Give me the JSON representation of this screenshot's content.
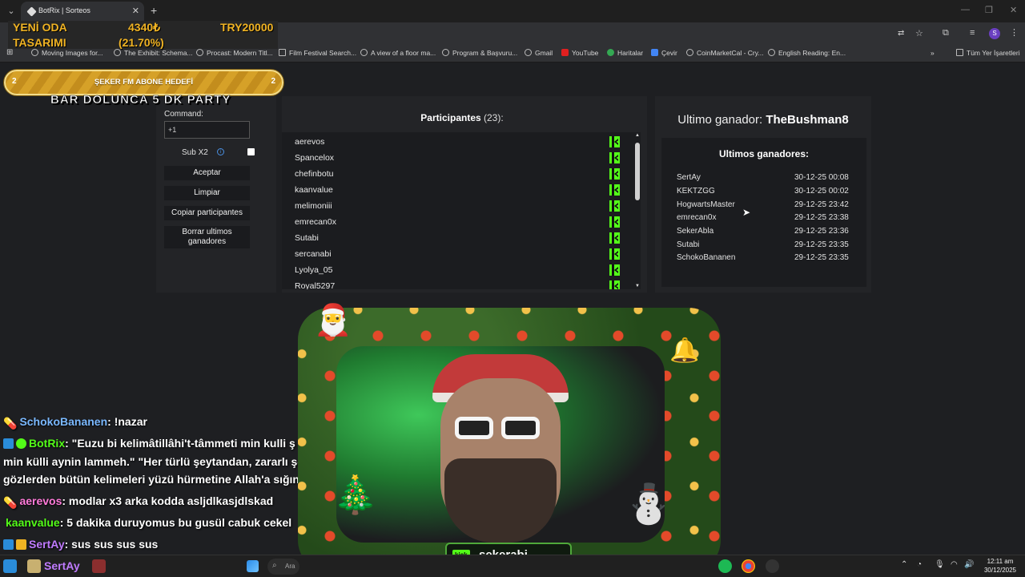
{
  "browser": {
    "tab_title": "BotRix | Sorteos",
    "new_tab": "+",
    "bookmarks": [
      {
        "label": "Moving Images for..."
      },
      {
        "label": "The Exhibit: Schema..."
      },
      {
        "label": "Procast: Modern Titl..."
      },
      {
        "label": "Film Festival Search..."
      },
      {
        "label": "A view of a floor ma..."
      },
      {
        "label": "Program & Başvuru..."
      },
      {
        "label": "Gmail"
      },
      {
        "label": "YouTube"
      },
      {
        "label": "Haritalar"
      },
      {
        "label": "Çevir"
      },
      {
        "label": "CoinMarketCal - Cry..."
      },
      {
        "label": "English Reading: En..."
      }
    ],
    "all_bookmarks": "Tüm Yer İşaretleri",
    "profile_initial": "S"
  },
  "stream_overlay": {
    "goal_label_line1": "YENİ ODA",
    "goal_label_line2": "TASARIMI",
    "amount": "4340₺",
    "percent": "(21.70%)",
    "target": "TRY20000",
    "progress_fraction": 0.217,
    "sub_goal": {
      "left_count": "2",
      "title": "ŞEKER FM ABONE HEDEFİ",
      "right_count": "2"
    },
    "party_text": "BAR DOLUNCA 5 DK PARTY"
  },
  "settings": {
    "command_label": "Command:",
    "command_value": "+1",
    "sub_x2_label": "Sub X2",
    "buttons": {
      "accept": "Aceptar",
      "clear": "Limpiar",
      "copy": "Copiar participantes",
      "delete_winners": "Borrar ultimos ganadores"
    }
  },
  "participants": {
    "title": "Participantes",
    "count": "(23):",
    "list": [
      "aerevos",
      "Spancelox",
      "chefinbotu",
      "kaanvalue",
      "melimoniii",
      "emrecan0x",
      "Sutabi",
      "sercanabi",
      "Lyolya_05",
      "Royal5297"
    ]
  },
  "winners": {
    "last_label": "Ultimo ganador:",
    "last_name": "TheBushman8",
    "list_title": "Ultimos ganadores:",
    "list": [
      {
        "name": "SertAy",
        "date": "30-12-25 00:08"
      },
      {
        "name": "KEKTZGG",
        "date": "30-12-25 00:02"
      },
      {
        "name": "HogwartsMaster",
        "date": "29-12-25 23:42"
      },
      {
        "name": "emrecan0x",
        "date": "29-12-25 23:38"
      },
      {
        "name": "SekerAbla",
        "date": "29-12-25 23:36"
      },
      {
        "name": "Sutabi",
        "date": "29-12-25 23:35"
      },
      {
        "name": "SchokoBananen",
        "date": "29-12-25 23:35"
      }
    ]
  },
  "chat": [
    {
      "user": "SchokoBananen",
      "text": ": !nazar",
      "color": "#7ab8ff"
    },
    {
      "user": "BotRix",
      "text": ": \"Euzu bi kelimâtillâhi't-tâmmeti min kulli ş",
      "color": "#53fc18"
    },
    {
      "user": "",
      "text": "min külli aynin lammeh.\" \"Her türlü şeytandan, zararlı şe",
      "color": "#ffffff"
    },
    {
      "user": "",
      "text": "gözlerden bütün kelimeleri yüzü hürmetine Allah'a sığın",
      "color": "#ffffff"
    },
    {
      "user": "aerevos",
      "text": ": modlar x3 arka kodda asljdlkasjdlskad",
      "color": "#ff7ad9"
    },
    {
      "user": "kaanvalue",
      "text": ": 5 dakika duruyomus bu gusül cabuk cekel",
      "color": "#53fc18"
    },
    {
      "user": "SertAy",
      "text": ": sus sus sus sus",
      "color": "#c07bff"
    }
  ],
  "streamer_badge": {
    "platform": "kick",
    "name": "şekerabi"
  },
  "taskbar": {
    "search_placeholder": "Ara",
    "taskbar_user": "SertAy",
    "time": "12:11 am",
    "date": "30/12/2025"
  },
  "colors": {
    "accent_gold": "#f0b323",
    "kick_green": "#53fc18",
    "panel_bg": "#232427"
  }
}
